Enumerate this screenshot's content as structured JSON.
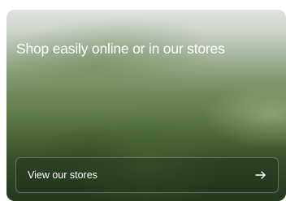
{
  "hero": {
    "headline": "Shop easily online or in our stores",
    "cta_label": "View our stores",
    "cta_icon": "arrow-right-icon"
  },
  "colors": {
    "text": "#ffffff",
    "landscape_green": "#5f7a49",
    "sky_haze": "#dfe3df"
  }
}
